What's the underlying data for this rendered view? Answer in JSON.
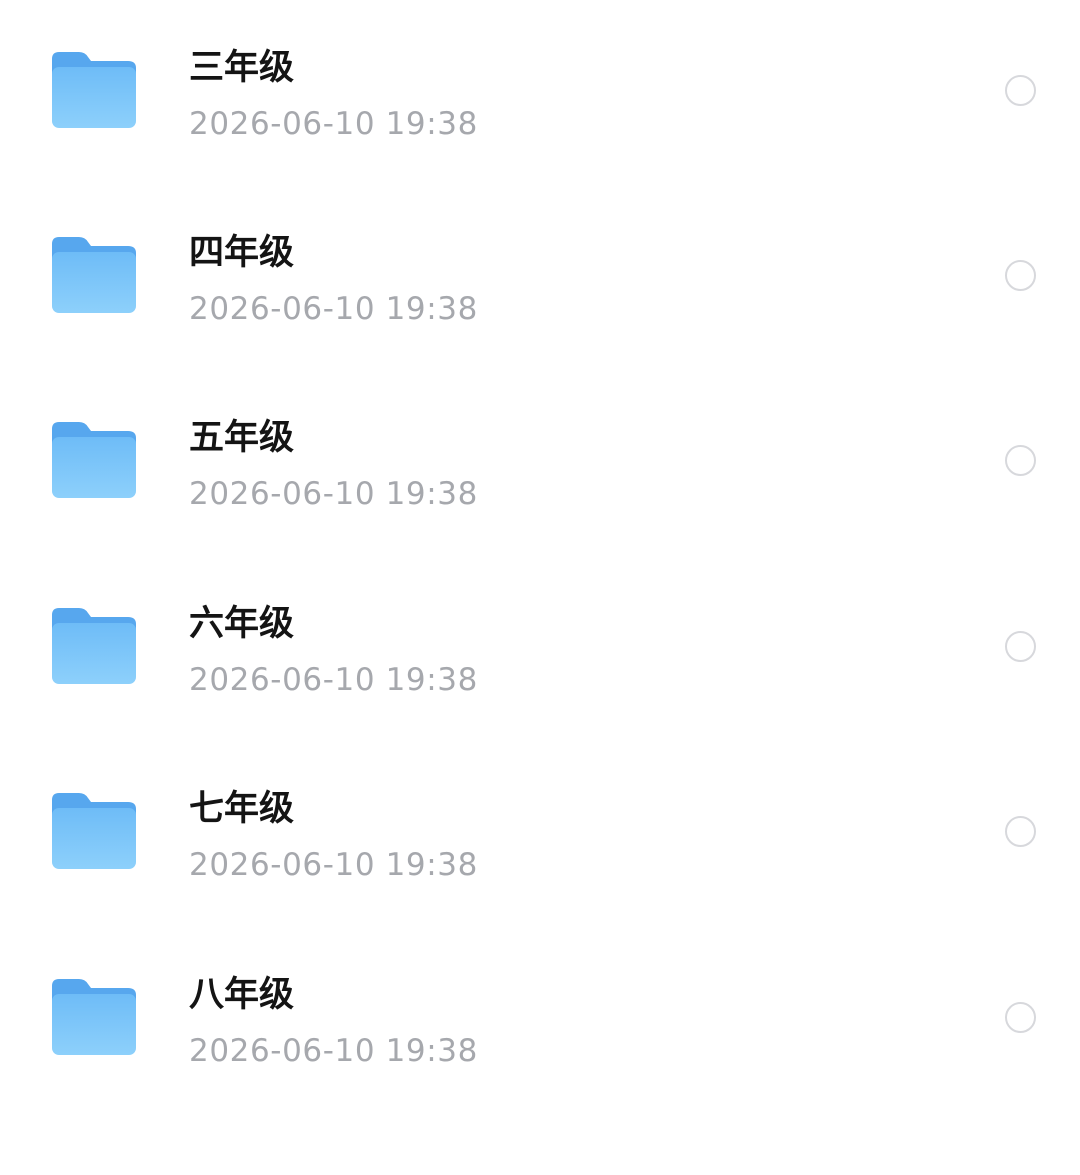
{
  "file_list": {
    "items": [
      {
        "name": "三年级",
        "date": "2026-06-10 19:38"
      },
      {
        "name": "四年级",
        "date": "2026-06-10 19:38"
      },
      {
        "name": "五年级",
        "date": "2026-06-10 19:38"
      },
      {
        "name": "六年级",
        "date": "2026-06-10 19:38"
      },
      {
        "name": "七年级",
        "date": "2026-06-10 19:38"
      },
      {
        "name": "八年级",
        "date": "2026-06-10 19:38"
      }
    ]
  },
  "colors": {
    "folder_back": "#57a7ee",
    "folder_front_top": "#6ebcf7",
    "folder_front_bottom": "#8dd0fb",
    "name_text": "#141414",
    "date_text": "#a6a8ad",
    "radio_border": "#d7d8dc"
  },
  "icons": {
    "folder": "folder-icon",
    "select": "radio-unchecked-icon"
  }
}
